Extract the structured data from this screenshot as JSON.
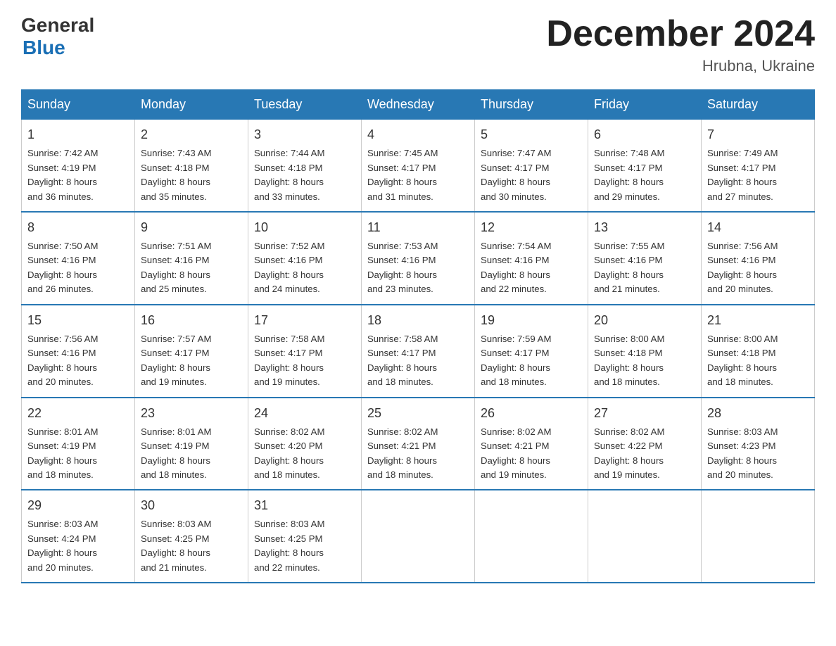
{
  "logo": {
    "general": "General",
    "blue": "Blue"
  },
  "title": "December 2024",
  "location": "Hrubna, Ukraine",
  "weekdays": [
    "Sunday",
    "Monday",
    "Tuesday",
    "Wednesday",
    "Thursday",
    "Friday",
    "Saturday"
  ],
  "weeks": [
    [
      {
        "day": "1",
        "sunrise": "7:42 AM",
        "sunset": "4:19 PM",
        "daylight": "8 hours and 36 minutes."
      },
      {
        "day": "2",
        "sunrise": "7:43 AM",
        "sunset": "4:18 PM",
        "daylight": "8 hours and 35 minutes."
      },
      {
        "day": "3",
        "sunrise": "7:44 AM",
        "sunset": "4:18 PM",
        "daylight": "8 hours and 33 minutes."
      },
      {
        "day": "4",
        "sunrise": "7:45 AM",
        "sunset": "4:17 PM",
        "daylight": "8 hours and 31 minutes."
      },
      {
        "day": "5",
        "sunrise": "7:47 AM",
        "sunset": "4:17 PM",
        "daylight": "8 hours and 30 minutes."
      },
      {
        "day": "6",
        "sunrise": "7:48 AM",
        "sunset": "4:17 PM",
        "daylight": "8 hours and 29 minutes."
      },
      {
        "day": "7",
        "sunrise": "7:49 AM",
        "sunset": "4:17 PM",
        "daylight": "8 hours and 27 minutes."
      }
    ],
    [
      {
        "day": "8",
        "sunrise": "7:50 AM",
        "sunset": "4:16 PM",
        "daylight": "8 hours and 26 minutes."
      },
      {
        "day": "9",
        "sunrise": "7:51 AM",
        "sunset": "4:16 PM",
        "daylight": "8 hours and 25 minutes."
      },
      {
        "day": "10",
        "sunrise": "7:52 AM",
        "sunset": "4:16 PM",
        "daylight": "8 hours and 24 minutes."
      },
      {
        "day": "11",
        "sunrise": "7:53 AM",
        "sunset": "4:16 PM",
        "daylight": "8 hours and 23 minutes."
      },
      {
        "day": "12",
        "sunrise": "7:54 AM",
        "sunset": "4:16 PM",
        "daylight": "8 hours and 22 minutes."
      },
      {
        "day": "13",
        "sunrise": "7:55 AM",
        "sunset": "4:16 PM",
        "daylight": "8 hours and 21 minutes."
      },
      {
        "day": "14",
        "sunrise": "7:56 AM",
        "sunset": "4:16 PM",
        "daylight": "8 hours and 20 minutes."
      }
    ],
    [
      {
        "day": "15",
        "sunrise": "7:56 AM",
        "sunset": "4:16 PM",
        "daylight": "8 hours and 20 minutes."
      },
      {
        "day": "16",
        "sunrise": "7:57 AM",
        "sunset": "4:17 PM",
        "daylight": "8 hours and 19 minutes."
      },
      {
        "day": "17",
        "sunrise": "7:58 AM",
        "sunset": "4:17 PM",
        "daylight": "8 hours and 19 minutes."
      },
      {
        "day": "18",
        "sunrise": "7:58 AM",
        "sunset": "4:17 PM",
        "daylight": "8 hours and 18 minutes."
      },
      {
        "day": "19",
        "sunrise": "7:59 AM",
        "sunset": "4:17 PM",
        "daylight": "8 hours and 18 minutes."
      },
      {
        "day": "20",
        "sunrise": "8:00 AM",
        "sunset": "4:18 PM",
        "daylight": "8 hours and 18 minutes."
      },
      {
        "day": "21",
        "sunrise": "8:00 AM",
        "sunset": "4:18 PM",
        "daylight": "8 hours and 18 minutes."
      }
    ],
    [
      {
        "day": "22",
        "sunrise": "8:01 AM",
        "sunset": "4:19 PM",
        "daylight": "8 hours and 18 minutes."
      },
      {
        "day": "23",
        "sunrise": "8:01 AM",
        "sunset": "4:19 PM",
        "daylight": "8 hours and 18 minutes."
      },
      {
        "day": "24",
        "sunrise": "8:02 AM",
        "sunset": "4:20 PM",
        "daylight": "8 hours and 18 minutes."
      },
      {
        "day": "25",
        "sunrise": "8:02 AM",
        "sunset": "4:21 PM",
        "daylight": "8 hours and 18 minutes."
      },
      {
        "day": "26",
        "sunrise": "8:02 AM",
        "sunset": "4:21 PM",
        "daylight": "8 hours and 19 minutes."
      },
      {
        "day": "27",
        "sunrise": "8:02 AM",
        "sunset": "4:22 PM",
        "daylight": "8 hours and 19 minutes."
      },
      {
        "day": "28",
        "sunrise": "8:03 AM",
        "sunset": "4:23 PM",
        "daylight": "8 hours and 20 minutes."
      }
    ],
    [
      {
        "day": "29",
        "sunrise": "8:03 AM",
        "sunset": "4:24 PM",
        "daylight": "8 hours and 20 minutes."
      },
      {
        "day": "30",
        "sunrise": "8:03 AM",
        "sunset": "4:25 PM",
        "daylight": "8 hours and 21 minutes."
      },
      {
        "day": "31",
        "sunrise": "8:03 AM",
        "sunset": "4:25 PM",
        "daylight": "8 hours and 22 minutes."
      },
      null,
      null,
      null,
      null
    ]
  ],
  "sunrise_label": "Sunrise:",
  "sunset_label": "Sunset:",
  "daylight_label": "Daylight:"
}
